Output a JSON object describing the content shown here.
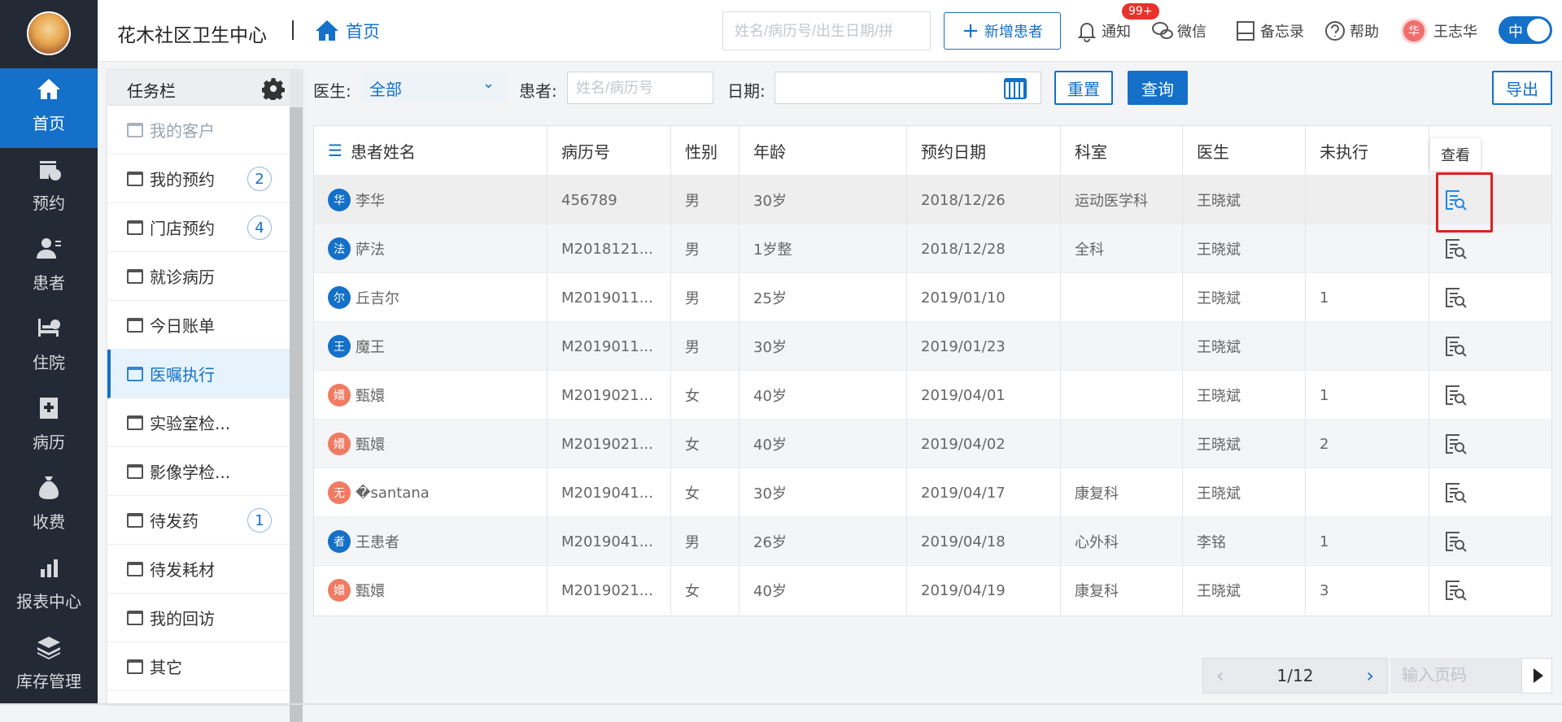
{
  "header": {
    "org_name": "花木社区卫生中心",
    "breadcrumb": "首页",
    "search_placeholder": "姓名/病历号/出生日期/拼",
    "new_patient_label": "新增患者",
    "notify_label": "通知",
    "notify_badge": "99+",
    "wechat_label": "微信",
    "memo_label": "备忘录",
    "help_label": "帮助",
    "user_avatar": "华",
    "user_name": "王志华",
    "lang_toggle": "中"
  },
  "nav": {
    "items": [
      {
        "label": "首页",
        "icon": "home-icon"
      },
      {
        "label": "预约",
        "icon": "calendar-clock-icon"
      },
      {
        "label": "患者",
        "icon": "patients-icon"
      },
      {
        "label": "住院",
        "icon": "bed-icon"
      },
      {
        "label": "病历",
        "icon": "medical-record-icon"
      },
      {
        "label": "收费",
        "icon": "money-bag-icon"
      },
      {
        "label": "报表中心",
        "icon": "bar-chart-icon"
      },
      {
        "label": "库存管理",
        "icon": "layers-icon"
      }
    ]
  },
  "taskbar": {
    "title": "任务栏",
    "items": [
      {
        "label": "我的客户",
        "count": ""
      },
      {
        "label": "我的预约",
        "count": "2"
      },
      {
        "label": "门店预约",
        "count": "4"
      },
      {
        "label": "就诊病历",
        "count": ""
      },
      {
        "label": "今日账单",
        "count": ""
      },
      {
        "label": "医嘱执行",
        "count": ""
      },
      {
        "label": "实验室检...",
        "count": ""
      },
      {
        "label": "影像学检...",
        "count": ""
      },
      {
        "label": "待发药",
        "count": "1"
      },
      {
        "label": "待发耗材",
        "count": ""
      },
      {
        "label": "我的回访",
        "count": ""
      },
      {
        "label": "其它",
        "count": ""
      }
    ]
  },
  "filters": {
    "doctor_label": "医生:",
    "doctor_value": "全部",
    "patient_label": "患者:",
    "patient_placeholder": "姓名/病历号",
    "date_label": "日期:",
    "reset_label": "重置",
    "query_label": "查询",
    "export_label": "导出"
  },
  "table": {
    "columns": [
      "患者姓名",
      "病历号",
      "性别",
      "年龄",
      "预约日期",
      "科室",
      "医生",
      "未执行"
    ],
    "rows": [
      {
        "avatar": "华",
        "gender_cls": "m",
        "name": "李华",
        "id": "456789",
        "gender": "男",
        "age": "30岁",
        "date": "2018/12/26",
        "dept": "运动医学科",
        "doctor": "王晓斌",
        "pending": ""
      },
      {
        "avatar": "法",
        "gender_cls": "m",
        "name": "萨法",
        "id": "M2018121...",
        "gender": "男",
        "age": "1岁整",
        "date": "2018/12/28",
        "dept": "全科",
        "doctor": "王晓斌",
        "pending": ""
      },
      {
        "avatar": "尔",
        "gender_cls": "m",
        "name": "丘吉尔",
        "id": "M2019011...",
        "gender": "男",
        "age": "25岁",
        "date": "2019/01/10",
        "dept": "",
        "doctor": "王晓斌",
        "pending": "1"
      },
      {
        "avatar": "王",
        "gender_cls": "m",
        "name": "魔王",
        "id": "M2019011...",
        "gender": "男",
        "age": "30岁",
        "date": "2019/01/23",
        "dept": "",
        "doctor": "王晓斌",
        "pending": ""
      },
      {
        "avatar": "嬛",
        "gender_cls": "f",
        "name": "甄嬛",
        "id": "M2019021...",
        "gender": "女",
        "age": "40岁",
        "date": "2019/04/01",
        "dept": "",
        "doctor": "王晓斌",
        "pending": "1"
      },
      {
        "avatar": "嬛",
        "gender_cls": "f",
        "name": "甄嬛",
        "id": "M2019021...",
        "gender": "女",
        "age": "40岁",
        "date": "2019/04/02",
        "dept": "",
        "doctor": "王晓斌",
        "pending": "2"
      },
      {
        "avatar": "无",
        "gender_cls": "f",
        "name": "�santana",
        "id": "M2019041...",
        "gender": "女",
        "age": "30岁",
        "date": "2019/04/17",
        "dept": "康复科",
        "doctor": "王晓斌",
        "pending": ""
      },
      {
        "avatar": "者",
        "gender_cls": "m",
        "name": "王患者",
        "id": "M2019041...",
        "gender": "男",
        "age": "26岁",
        "date": "2019/04/18",
        "dept": "心外科",
        "doctor": "李铭",
        "pending": "1"
      },
      {
        "avatar": "嬛",
        "gender_cls": "f",
        "name": "甄嬛",
        "id": "M2019021...",
        "gender": "女",
        "age": "40岁",
        "date": "2019/04/19",
        "dept": "康复科",
        "doctor": "王晓斌",
        "pending": "3"
      }
    ],
    "view_tooltip": "查看"
  },
  "pagination": {
    "page": "1/12",
    "goto_placeholder": "输入页码"
  },
  "colors": {
    "primary": "#1470c8",
    "sidebar": "#232a35",
    "badge": "#e8322c",
    "highlight": "#e02020"
  }
}
